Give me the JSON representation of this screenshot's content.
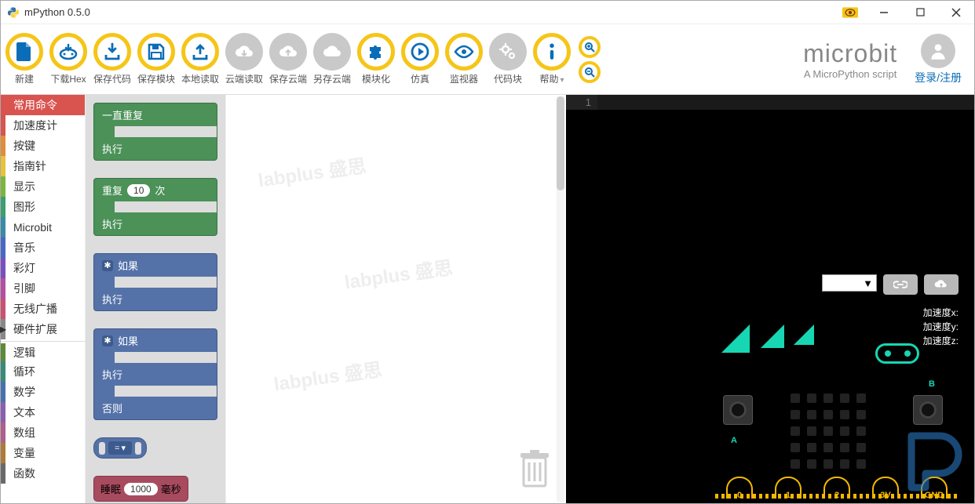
{
  "window": {
    "title": "mPython 0.5.0"
  },
  "toolbar": [
    {
      "id": "new",
      "label": "新建",
      "style": "yellow",
      "icon": "file"
    },
    {
      "id": "dlhex",
      "label": "下载Hex",
      "style": "yellow",
      "icon": "download-chip"
    },
    {
      "id": "savecode",
      "label": "保存代码",
      "style": "yellow",
      "icon": "save-down"
    },
    {
      "id": "saveblock",
      "label": "保存模块",
      "style": "yellow",
      "icon": "floppy"
    },
    {
      "id": "localread",
      "label": "本地读取",
      "style": "yellow",
      "icon": "upload"
    },
    {
      "id": "cloudread",
      "label": "云端读取",
      "style": "gray",
      "icon": "cloud-down"
    },
    {
      "id": "savecloud",
      "label": "保存云端",
      "style": "gray",
      "icon": "cloud-up"
    },
    {
      "id": "saveascloud",
      "label": "另存云端",
      "style": "gray",
      "icon": "cloud"
    },
    {
      "id": "blockify",
      "label": "模块化",
      "style": "yellow",
      "icon": "puzzle"
    },
    {
      "id": "simulate",
      "label": "仿真",
      "style": "yellow",
      "icon": "play-circle"
    },
    {
      "id": "monitor",
      "label": "监视器",
      "style": "yellow",
      "icon": "eye"
    },
    {
      "id": "codeblock",
      "label": "代码块",
      "style": "gray",
      "icon": "gears"
    },
    {
      "id": "help",
      "label": "帮助",
      "style": "yellow",
      "icon": "info",
      "chev": true
    }
  ],
  "brand": {
    "name": "microbit",
    "tagline": "A MicroPython script"
  },
  "user": {
    "login_label": "登录/注册"
  },
  "categories": [
    {
      "label": "常用命令",
      "color": "#d9534f",
      "active": true
    },
    {
      "label": "加速度计",
      "color": "#d9534f"
    },
    {
      "label": "按键",
      "color": "#e28d3c"
    },
    {
      "label": "指南针",
      "color": "#e8c23b"
    },
    {
      "label": "显示",
      "color": "#7eb53e"
    },
    {
      "label": "图形",
      "color": "#3d9e72"
    },
    {
      "label": "Microbit",
      "color": "#3b8aa8"
    },
    {
      "label": "音乐",
      "color": "#4a67c7"
    },
    {
      "label": "彩灯",
      "color": "#7a4fc1"
    },
    {
      "label": "引脚",
      "color": "#b54fa1"
    },
    {
      "label": "无线广播",
      "color": "#c95270"
    },
    {
      "label": "硬件扩展",
      "color": "#888",
      "arrow": true
    },
    {
      "label": "逻辑",
      "color": "#5d8a3a",
      "sep": true
    },
    {
      "label": "循环",
      "color": "#3a8a7a"
    },
    {
      "label": "数学",
      "color": "#4a6fae"
    },
    {
      "label": "文本",
      "color": "#8a5fae"
    },
    {
      "label": "数组",
      "color": "#ae5f8a"
    },
    {
      "label": "变量",
      "color": "#ae7a3a"
    },
    {
      "label": "函数",
      "color": "#6a6a6a"
    }
  ],
  "blocks": {
    "forever_top": "一直重复",
    "forever_do": "执行",
    "repeat": "重复",
    "repeat_n": "10",
    "times": "次",
    "do": "执行",
    "if": "如果",
    "else": "否则",
    "eq": "=",
    "sleep": "睡眠",
    "sleep_n": "1000",
    "ms": "毫秒"
  },
  "editor": {
    "line1": "1"
  },
  "sim": {
    "accel_x": "加速度x:",
    "accel_y": "加速度y:",
    "accel_z": "加速度z:",
    "a": "A",
    "b": "B",
    "pins": [
      "0",
      "1",
      "2",
      "3V",
      "GND"
    ]
  }
}
